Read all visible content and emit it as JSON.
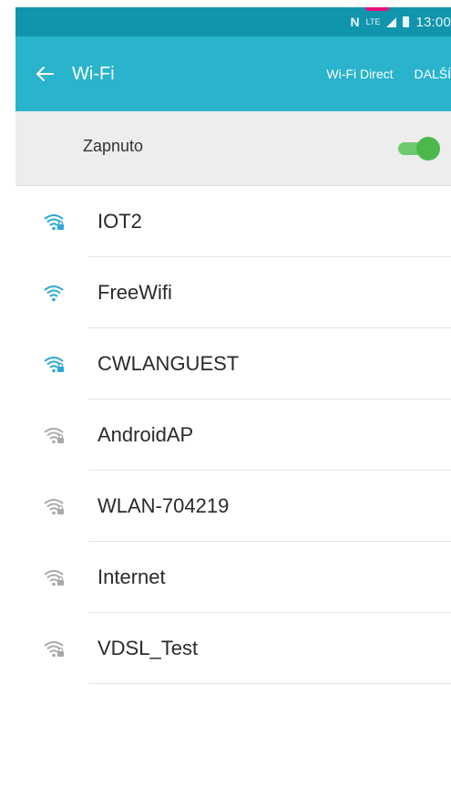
{
  "status_bar": {
    "nfc": "N",
    "lte": "LTE",
    "time": "13:00"
  },
  "toolbar": {
    "title": "Wi-Fi",
    "wifi_direct": "Wi-Fi Direct",
    "more": "DALŠÍ"
  },
  "toggle": {
    "label": "Zapnuto",
    "state": "on"
  },
  "colors": {
    "statusbar": "#1195ad",
    "toolbar": "#2ab3cc",
    "toggle_on": "#4cb84c",
    "wifi_active": "#2aa7d8",
    "wifi_inactive": "#a9a9a9"
  },
  "networks": [
    {
      "name": "IOT2",
      "icon": "wifi-lock-icon",
      "signal": "strong-blue"
    },
    {
      "name": "FreeWifi",
      "icon": "wifi-icon",
      "signal": "strong-blue"
    },
    {
      "name": "CWLANGUEST",
      "icon": "wifi-lock-icon",
      "signal": "strong-blue"
    },
    {
      "name": "AndroidAP",
      "icon": "wifi-lock-icon",
      "signal": "grey"
    },
    {
      "name": "WLAN-704219",
      "icon": "wifi-lock-icon",
      "signal": "grey"
    },
    {
      "name": "Internet",
      "icon": "wifi-lock-icon",
      "signal": "grey"
    },
    {
      "name": "VDSL_Test",
      "icon": "wifi-lock-icon",
      "signal": "grey"
    }
  ]
}
